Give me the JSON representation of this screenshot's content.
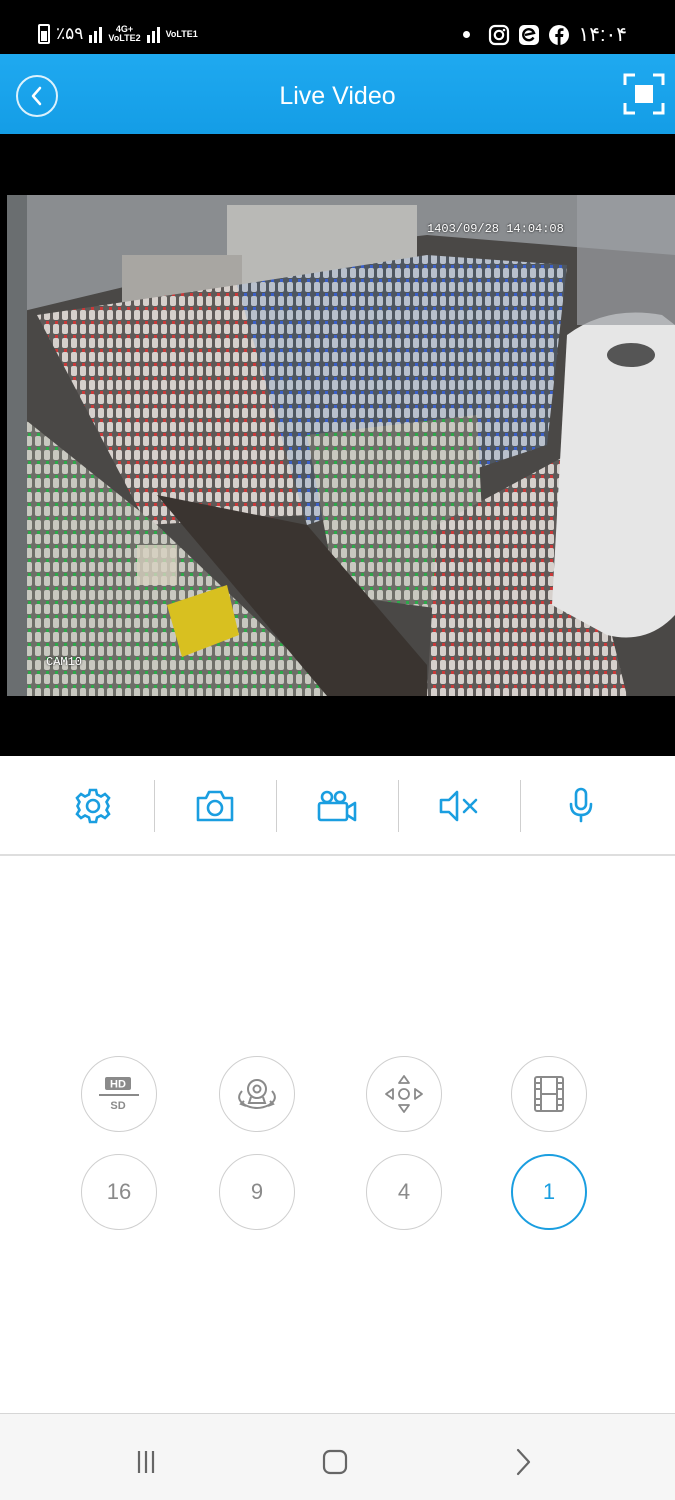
{
  "status_bar": {
    "battery": "٪۵۹",
    "net1": "4G+",
    "net1b": "VoLTE2",
    "net2": "VoLTE1",
    "time": "۱۴:۰۴"
  },
  "header": {
    "title": "Live Video"
  },
  "video": {
    "timestamp": "1403/09/28 14:04:08",
    "camera_label": "CAM10"
  },
  "toolbar": {
    "icons": [
      "gear-icon",
      "camera-icon",
      "video-camera-icon",
      "speaker-mute-icon",
      "microphone-icon"
    ]
  },
  "controls": {
    "hd_label": "HD",
    "sd_label": "SD",
    "grid_16": "16",
    "grid_9": "9",
    "grid_4": "4",
    "grid_1": "1"
  },
  "colors": {
    "accent": "#1a9ee0",
    "header": "#1fa9f0"
  }
}
